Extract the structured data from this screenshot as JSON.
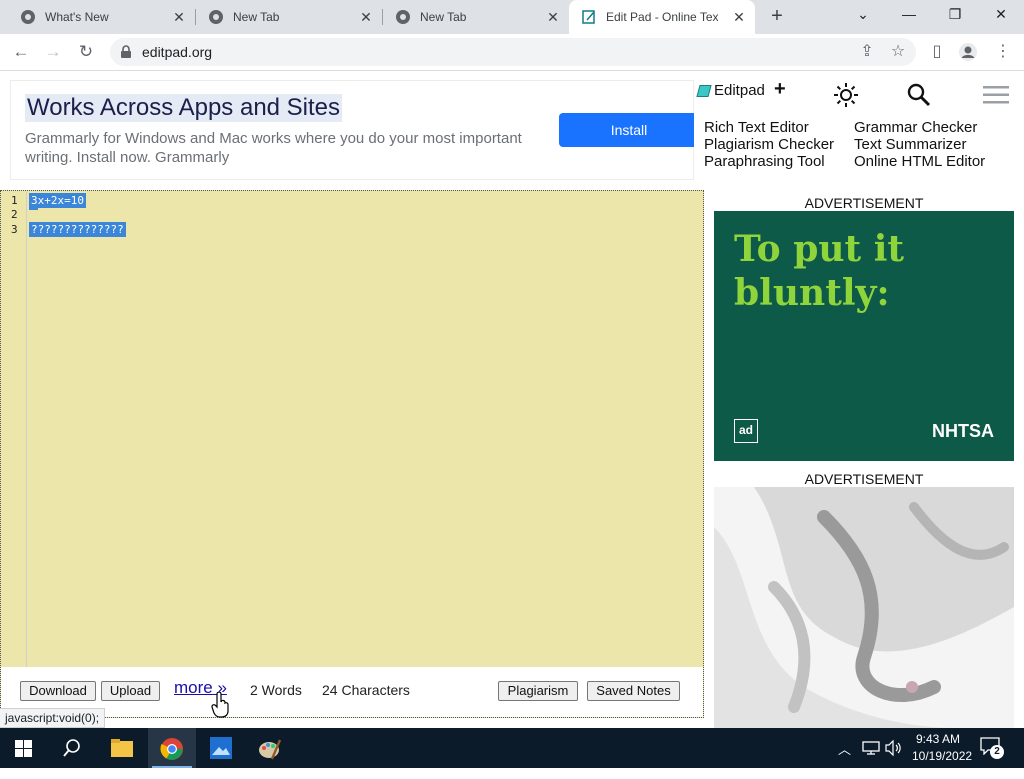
{
  "browser": {
    "tabs": [
      {
        "title": "What's New",
        "active": false
      },
      {
        "title": "New Tab",
        "active": false
      },
      {
        "title": "New Tab",
        "active": false
      },
      {
        "title": "Edit Pad - Online Text E",
        "active": true
      }
    ],
    "url": "editpad.org"
  },
  "grammarly_ad": {
    "title": "Works Across Apps and Sites",
    "body": "Grammarly for Windows and Mac works where you do your most important writing. Install now. Grammarly",
    "install_label": "Install"
  },
  "site_nav": {
    "logo_text": "Editpad",
    "plus_label": "+",
    "links_col1": [
      "Rich Text Editor",
      "Plagiarism Checker",
      "Paraphrasing Tool"
    ],
    "links_col2": [
      "Grammar Checker",
      "Text Summarizer",
      "Online HTML Editor"
    ]
  },
  "editor": {
    "line_numbers": [
      "1",
      "2",
      "3"
    ],
    "lines": [
      "3x+2x=10",
      " ",
      "??????????????"
    ],
    "download_label": "Download",
    "upload_label": "Upload",
    "more_label": "more »",
    "word_count": "2 Words",
    "char_count": "24 Characters",
    "plagiarism_label": "Plagiarism",
    "saved_notes_label": "Saved Notes"
  },
  "ads": {
    "label1": "ADVERTISEMENT",
    "label2": "ADVERTISEMENT",
    "ad1_headline_line1": "To put it",
    "ad1_headline_line2": "bluntly:",
    "ad1_logo_left": "ad",
    "ad1_logo_right": "NHTSA"
  },
  "status_tip": "javascript:void(0);",
  "taskbar": {
    "time": "9:43 AM",
    "date": "10/19/2022",
    "notification_count": "2"
  },
  "colors": {
    "editor_bg": "#ece6aa",
    "selection": "#3b86d8",
    "install_button": "#1a73ff",
    "ad1_bg": "#0d5a48",
    "ad1_text": "#8fd43a"
  }
}
